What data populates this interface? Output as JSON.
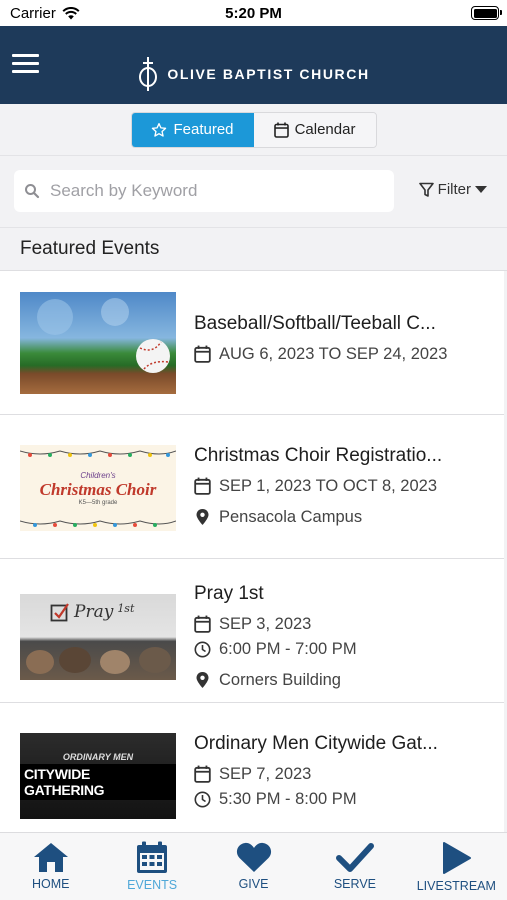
{
  "status_bar": {
    "carrier": "Carrier",
    "time": "5:20 PM"
  },
  "header": {
    "title": "OLIVE BAPTIST CHURCH"
  },
  "segments": {
    "featured": "Featured",
    "calendar": "Calendar",
    "active": "featured"
  },
  "search": {
    "placeholder": "Search by Keyword",
    "value": ""
  },
  "filter": {
    "label": "Filter"
  },
  "section": {
    "title": "Featured Events"
  },
  "events": [
    {
      "title": "Baseball/Softball/Teeball C...",
      "date": "AUG 6, 2023 TO SEP 24, 2023"
    },
    {
      "title": "Christmas Choir Registratio...",
      "date": "SEP 1, 2023 TO OCT 8, 2023",
      "location": "Pensacola Campus",
      "thumb_text": {
        "line1": "Children's",
        "line2": "Christmas Choir",
        "line3": "K5—5th grade"
      }
    },
    {
      "title": "Pray 1st",
      "date": "SEP 3, 2023",
      "time": "6:00 PM - 7:00 PM",
      "location": "Corners Building",
      "thumb_text": {
        "line1": "Pray",
        "line2": "1st"
      }
    },
    {
      "title": "Ordinary Men Citywide Gat...",
      "date": "SEP 7, 2023",
      "time": "5:30 PM - 8:00 PM",
      "thumb_text": {
        "line1": "ORDINARY MEN",
        "line2": "CITYWIDE GATHERING"
      }
    }
  ],
  "tabs": [
    {
      "label": "HOME",
      "icon": "home-icon"
    },
    {
      "label": "EVENTS",
      "icon": "calendar-icon",
      "active": true
    },
    {
      "label": "GIVE",
      "icon": "heart-icon"
    },
    {
      "label": "SERVE",
      "icon": "checkmark-icon"
    },
    {
      "label": "LIVESTREAM",
      "icon": "play-icon"
    }
  ],
  "colors": {
    "header": "#1e3a5a",
    "accent": "#1c98d8",
    "tab_icon": "#1e4f80",
    "tab_active": "#4fa8d8"
  }
}
